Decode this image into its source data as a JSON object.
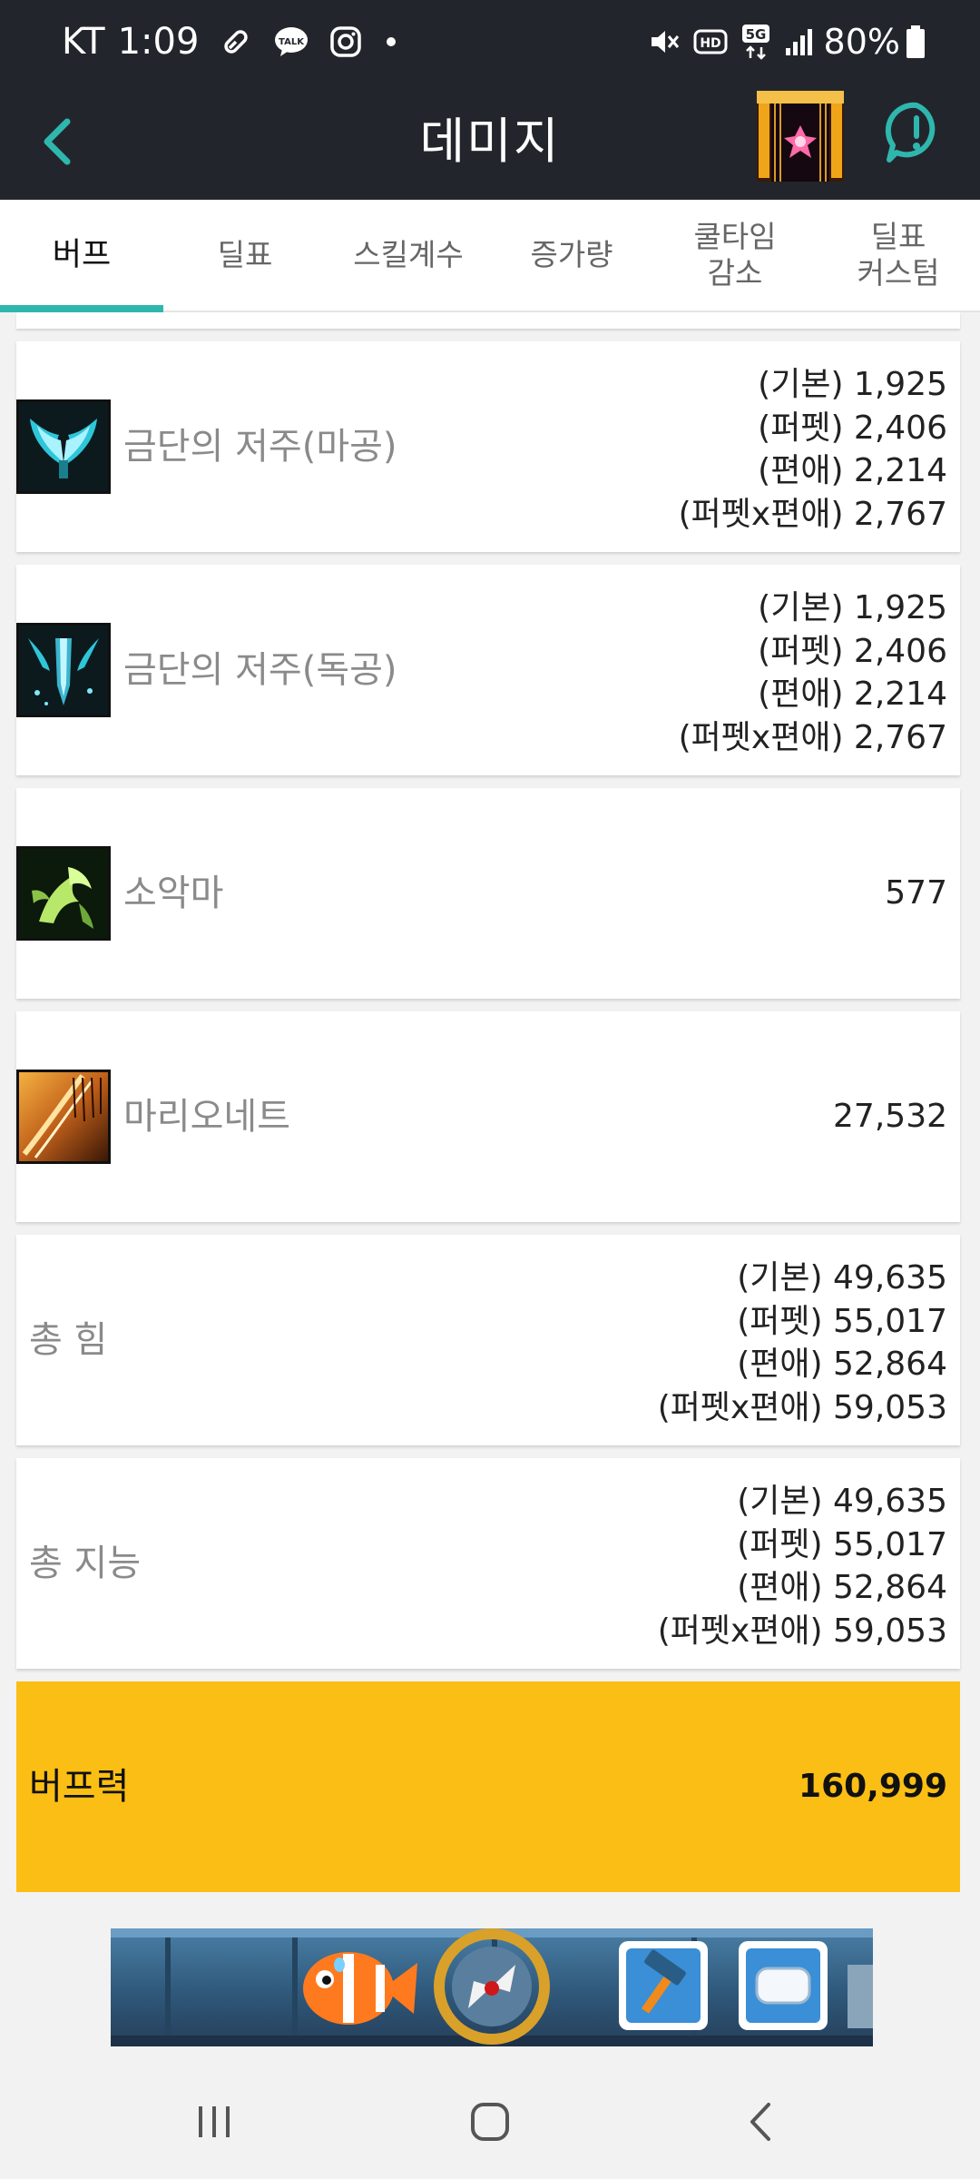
{
  "status_bar": {
    "carrier": "KT",
    "time": "1:09",
    "battery": "80%"
  },
  "header": {
    "title": "데미지"
  },
  "tabs": [
    {
      "label": "버프",
      "active": true
    },
    {
      "label": "딜표",
      "active": false
    },
    {
      "label": "스킬계수",
      "active": false
    },
    {
      "label": "증가량",
      "active": false
    },
    {
      "label": "쿨타임\n감소",
      "active": false
    },
    {
      "label": "딜표\n커스텀",
      "active": false
    }
  ],
  "rows": [
    {
      "name": "금단의 저주(마공)",
      "icon": "wing-skill-icon",
      "lines": [
        "(기본) 1,925",
        "(퍼펫) 2,406",
        "(편애) 2,214",
        "(퍼펫x편애) 2,767"
      ]
    },
    {
      "name": "금단의 저주(독공)",
      "icon": "blade-skill-icon",
      "lines": [
        "(기본) 1,925",
        "(퍼펫) 2,406",
        "(편애) 2,214",
        "(퍼펫x편애) 2,767"
      ]
    },
    {
      "name": "소악마",
      "icon": "imp-skill-icon",
      "value": "577"
    },
    {
      "name": "마리오네트",
      "icon": "marionette-skill-icon",
      "value": "27,532"
    },
    {
      "name": "총 힘",
      "lines": [
        "(기본) 49,635",
        "(퍼펫) 55,017",
        "(편애) 52,864",
        "(퍼펫x편애) 59,053"
      ]
    },
    {
      "name": "총 지능",
      "lines": [
        "(기본) 49,635",
        "(퍼펫) 55,017",
        "(편애) 52,864",
        "(퍼펫x편애) 59,053"
      ]
    }
  ],
  "total": {
    "label": "버프력",
    "value": "160,999"
  },
  "colors": {
    "app_bar": "#22262c",
    "accent": "#2fb7ae",
    "total_bg": "#fbbe14"
  }
}
